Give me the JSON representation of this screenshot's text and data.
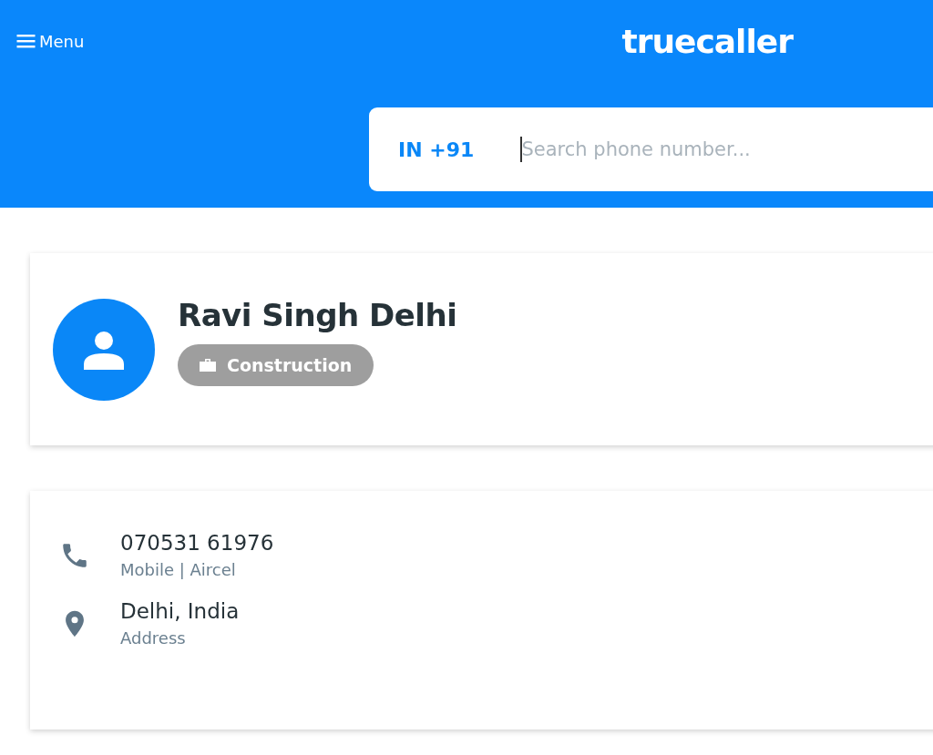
{
  "header": {
    "menu_label": "Menu",
    "logo": "truecaller"
  },
  "search": {
    "country_code": "IN +91",
    "placeholder": "Search phone number..."
  },
  "profile": {
    "name": "Ravi Singh Delhi",
    "tag": "Construction"
  },
  "details": [
    {
      "kind": "phone",
      "primary": "070531 61976",
      "secondary": "Mobile | Aircel"
    },
    {
      "kind": "address",
      "primary": "Delhi, India",
      "secondary": "Address"
    }
  ]
}
